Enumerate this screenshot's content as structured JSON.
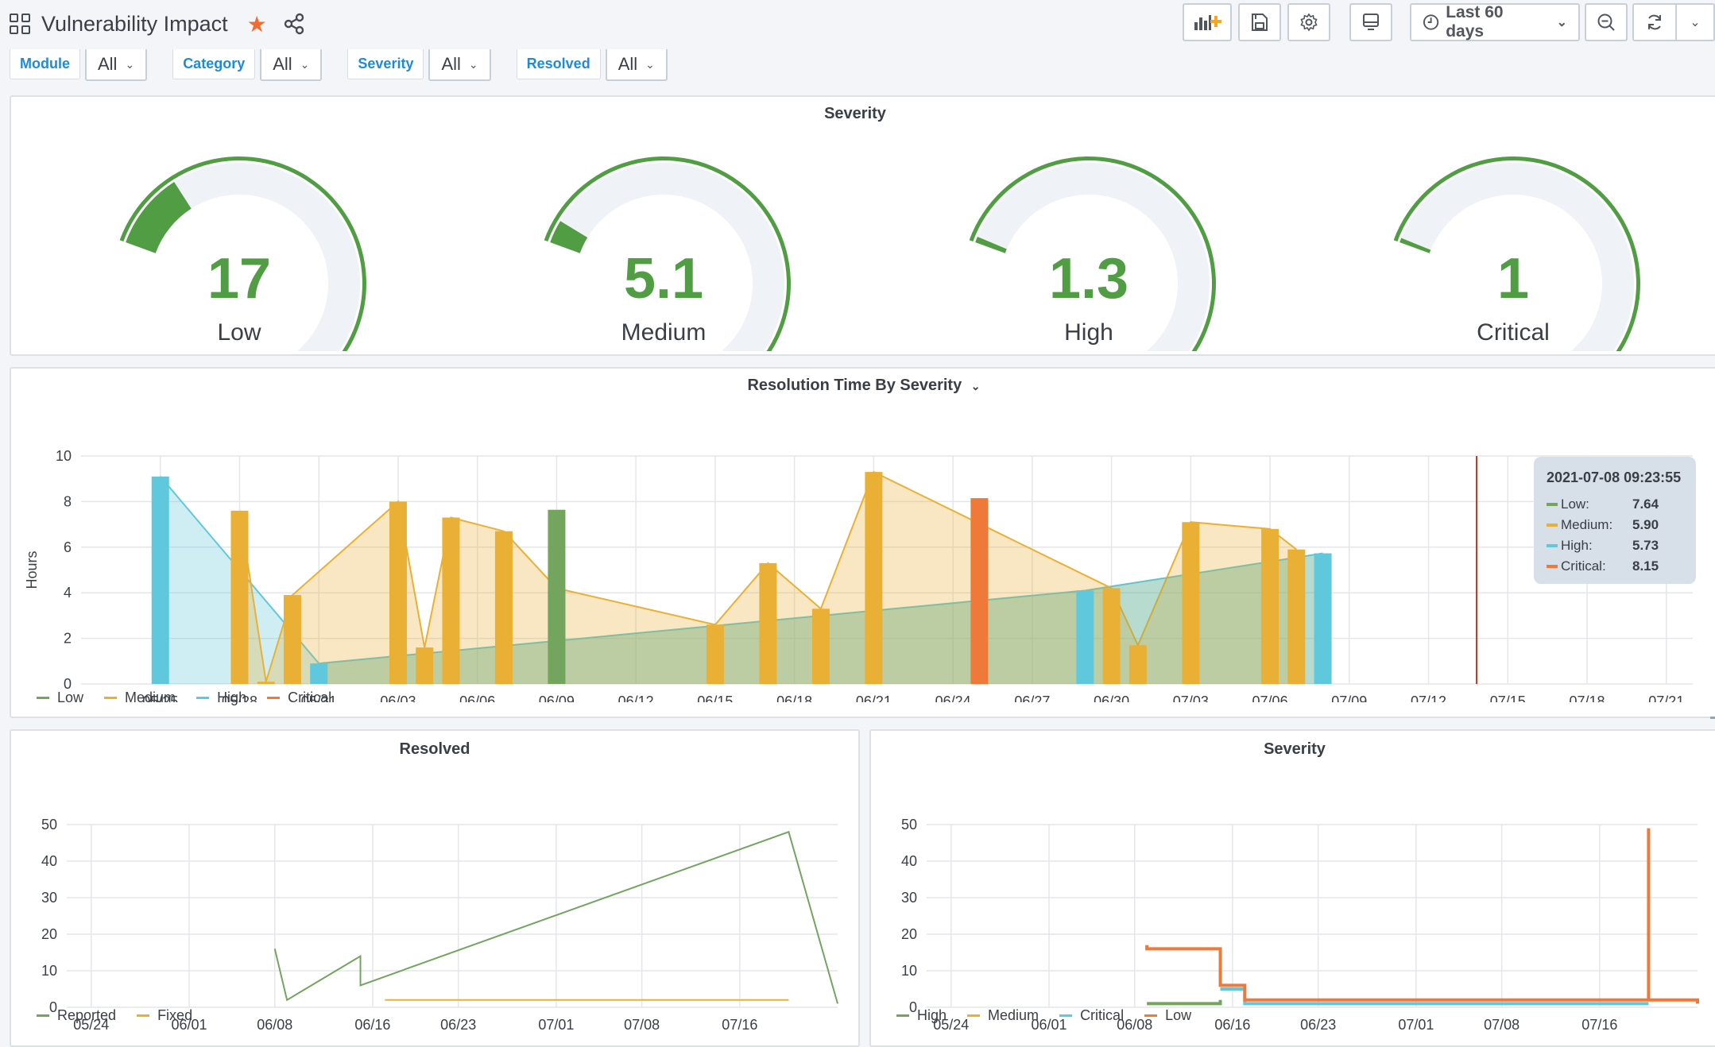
{
  "header": {
    "title": "Vulnerability Impact",
    "icons": {
      "apps": "apps-grid-icon",
      "star": "star-icon",
      "share": "share-icon"
    },
    "toolbar": {
      "add_panel": "add-panel-icon",
      "save": "save-icon",
      "settings": "gear-icon",
      "tv_mode": "monitor-icon",
      "time_range_label": "Last 60 days",
      "zoom_out": "zoom-out-icon",
      "refresh": "refresh-icon",
      "refresh_dropdown": "chevron-down-icon"
    }
  },
  "filters": [
    {
      "label": "Module",
      "value": "All"
    },
    {
      "label": "Category",
      "value": "All"
    },
    {
      "label": "Severity",
      "value": "All"
    },
    {
      "label": "Resolved",
      "value": "All"
    }
  ],
  "colors": {
    "green": "#509d43",
    "medium": "#e9b035",
    "high": "#5fc8dc",
    "critical": "#ef7939",
    "track": "#eff2f6",
    "accent": "#1f8bd8"
  },
  "severity_gauges": {
    "title": "Severity",
    "min": 0,
    "max": 100,
    "items": [
      {
        "label": "Low",
        "value": "17",
        "num": 17
      },
      {
        "label": "Medium",
        "value": "5.1",
        "num": 5.1
      },
      {
        "label": "High",
        "value": "1.3",
        "num": 1.3
      },
      {
        "label": "Critical",
        "value": "1",
        "num": 1
      }
    ]
  },
  "chart_data": [
    {
      "id": "resolution",
      "type": "bar",
      "title": "Resolution Time By Severity",
      "ylabel": "Hours",
      "xlabel": "",
      "ylim": [
        0,
        10
      ],
      "yticks": [
        0,
        2,
        4,
        6,
        8,
        10
      ],
      "xrange_days": [
        "2021-05-22",
        "2021-07-22"
      ],
      "xticks": [
        "05/25",
        "05/28",
        "05/31",
        "06/03",
        "06/06",
        "06/09",
        "06/12",
        "06/15",
        "06/18",
        "06/21",
        "06/24",
        "06/27",
        "06/30",
        "07/03",
        "07/06",
        "07/09",
        "07/12",
        "07/15",
        "07/18",
        "07/21"
      ],
      "grid": true,
      "legend_position": "bottom-left",
      "series": [
        {
          "name": "Low",
          "color": "#73a55e",
          "points": [
            [
              "06/09",
              7.64
            ]
          ]
        },
        {
          "name": "Medium",
          "color": "#e9b035",
          "points": [
            [
              "05/28",
              7.6
            ],
            [
              "05/29",
              0.1
            ],
            [
              "05/30",
              3.9
            ],
            [
              "06/03",
              8.0
            ],
            [
              "06/04",
              1.6
            ],
            [
              "06/05",
              7.3
            ],
            [
              "06/07",
              6.7
            ],
            [
              "06/09",
              4.2
            ],
            [
              "06/15",
              2.6
            ],
            [
              "06/17",
              5.3
            ],
            [
              "06/19",
              3.3
            ],
            [
              "06/21",
              9.3
            ],
            [
              "06/30",
              4.2
            ],
            [
              "07/01",
              1.7
            ],
            [
              "07/03",
              7.1
            ],
            [
              "07/06",
              6.8
            ],
            [
              "07/07",
              5.9
            ]
          ]
        },
        {
          "name": "High",
          "color": "#5fc8dc",
          "points": [
            [
              "05/25",
              9.1
            ],
            [
              "05/31",
              0.9
            ],
            [
              "06/29",
              4.1
            ],
            [
              "07/08",
              5.73
            ]
          ]
        },
        {
          "name": "Critical",
          "color": "#ef7939",
          "points": [
            [
              "06/25",
              8.15
            ]
          ]
        }
      ],
      "annotation": {
        "type": "vertical-line",
        "at": "07/14",
        "color": "#c0392b"
      },
      "tooltip": {
        "time": "2021-07-08 09:23:55",
        "rows": [
          {
            "name": "Low:",
            "value": "7.64",
            "color": "#73a55e"
          },
          {
            "name": "Medium:",
            "value": "5.90",
            "color": "#e9b035"
          },
          {
            "name": "High:",
            "value": "5.73",
            "color": "#5fc8dc"
          },
          {
            "name": "Critical:",
            "value": "8.15",
            "color": "#ef7939"
          }
        ]
      }
    },
    {
      "id": "resolved",
      "type": "line",
      "title": "Resolved",
      "xlabel": "",
      "ylabel": "",
      "ylim": [
        0,
        50
      ],
      "yticks": [
        0,
        10,
        20,
        30,
        40,
        50
      ],
      "xrange_days": [
        "2021-05-22",
        "2021-07-24"
      ],
      "xticks": [
        "05/24",
        "06/01",
        "06/08",
        "06/16",
        "06/23",
        "07/01",
        "07/08",
        "07/16"
      ],
      "grid": true,
      "legend_position": "bottom-left",
      "series": [
        {
          "name": "Reported",
          "color": "#73a55e",
          "points": [
            [
              "06/08",
              16
            ],
            [
              "06/09",
              2
            ],
            [
              "06/15",
              14
            ],
            [
              "06/15",
              6
            ],
            [
              "07/20",
              48
            ],
            [
              "07/24",
              1
            ]
          ]
        },
        {
          "name": "Fixed",
          "color": "#e9b035",
          "points": [
            [
              "06/17",
              2
            ],
            [
              "07/20",
              2
            ]
          ]
        }
      ]
    },
    {
      "id": "severity_ts",
      "type": "line",
      "title": "Severity",
      "xlabel": "",
      "ylabel": "",
      "ylim": [
        0,
        50
      ],
      "yticks": [
        0,
        10,
        20,
        30,
        40,
        50
      ],
      "xrange_days": [
        "2021-05-22",
        "2021-07-24"
      ],
      "xticks": [
        "05/24",
        "06/01",
        "06/08",
        "06/16",
        "06/23",
        "07/01",
        "07/08",
        "07/16"
      ],
      "grid": true,
      "legend_position": "bottom-left",
      "series": [
        {
          "name": "High",
          "color": "#73a55e",
          "points": [
            [
              "06/09",
              1
            ],
            [
              "06/15",
              1
            ],
            [
              "06/15",
              2
            ]
          ]
        },
        {
          "name": "Medium",
          "color": "#e9b035",
          "points": []
        },
        {
          "name": "Critical",
          "color": "#5fc8dc",
          "points": [
            [
              "06/15",
              5
            ],
            [
              "06/17",
              5
            ],
            [
              "06/17",
              1
            ],
            [
              "07/20",
              1
            ]
          ]
        },
        {
          "name": "Low",
          "color": "#ef7939",
          "points": [
            [
              "06/09",
              17
            ],
            [
              "06/09",
              16
            ],
            [
              "06/15",
              16
            ],
            [
              "06/15",
              6
            ],
            [
              "06/17",
              6
            ],
            [
              "06/17",
              2
            ],
            [
              "07/20",
              2
            ],
            [
              "07/20",
              49
            ],
            [
              "07/20",
              2
            ],
            [
              "07/24",
              2
            ],
            [
              "07/24",
              1
            ]
          ]
        }
      ]
    }
  ]
}
